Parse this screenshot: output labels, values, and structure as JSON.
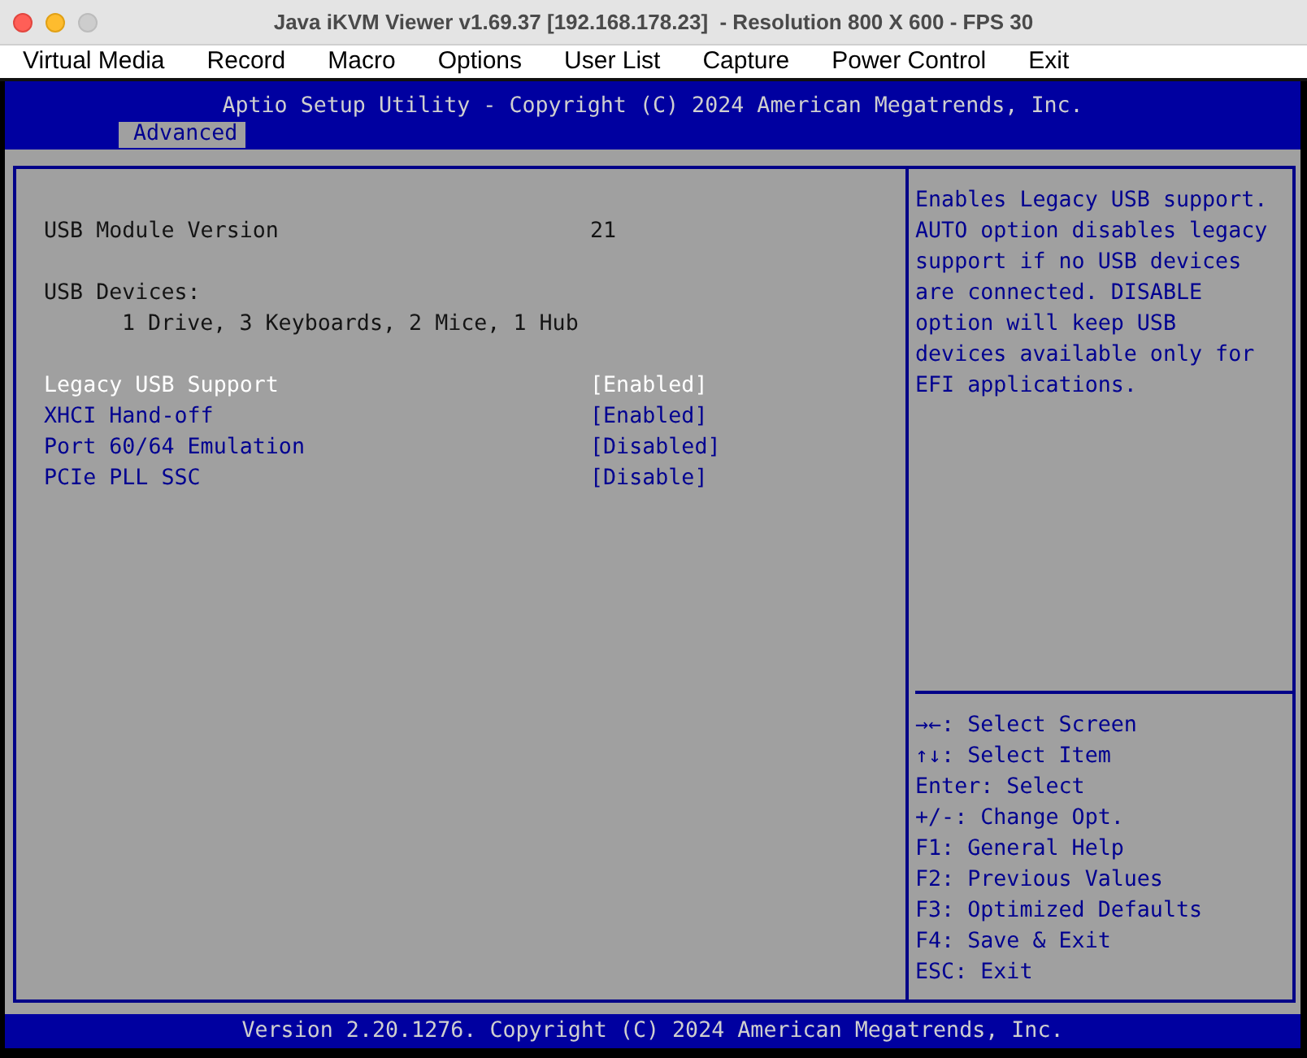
{
  "window": {
    "title": "Java iKVM Viewer v1.69.37 [192.168.178.23]  - Resolution 800 X 600 - FPS 30",
    "controls": [
      {
        "kind": "close",
        "disabled": false
      },
      {
        "kind": "minimize",
        "disabled": false
      },
      {
        "kind": "zoom",
        "disabled": true
      }
    ]
  },
  "menu_bar": [
    "Virtual Media",
    "Record",
    "Macro",
    "Options",
    "User List",
    "Capture",
    "Power Control",
    "Exit"
  ],
  "bios": {
    "header": {
      "title": "Aptio Setup Utility - Copyright (C) 2024 American Megatrends, Inc.",
      "tabs": [
        {
          "label": "Advanced",
          "selected": true
        }
      ]
    },
    "info": [
      {
        "label": "USB Module Version",
        "value": "21"
      }
    ],
    "devices": {
      "label": "USB Devices:",
      "value": "1 Drive, 3 Keyboards, 2 Mice, 1 Hub"
    },
    "settings": [
      {
        "label": "Legacy USB Support",
        "value": "[Enabled]",
        "selected": true
      },
      {
        "label": "XHCI Hand-off",
        "value": "[Enabled]",
        "selected": false
      },
      {
        "label": "Port 60/64 Emulation",
        "value": "[Disabled]",
        "selected": false
      },
      {
        "label": "PCIe PLL SSC",
        "value": "[Disable]",
        "selected": false
      }
    ],
    "help_text": "Enables Legacy USB support. AUTO option disables legacy support if no USB devices are connected. DISABLE option will keep USB devices available only for EFI applications.",
    "key_help": [
      "→←: Select Screen",
      "↑↓: Select Item",
      "Enter: Select",
      "+/-: Change Opt.",
      "F1: General Help",
      "F2: Previous Values",
      "F3: Optimized Defaults",
      "F4: Save & Exit",
      "ESC: Exit"
    ],
    "footer": "Version 2.20.1276. Copyright (C) 2024 American Megatrends, Inc."
  }
}
